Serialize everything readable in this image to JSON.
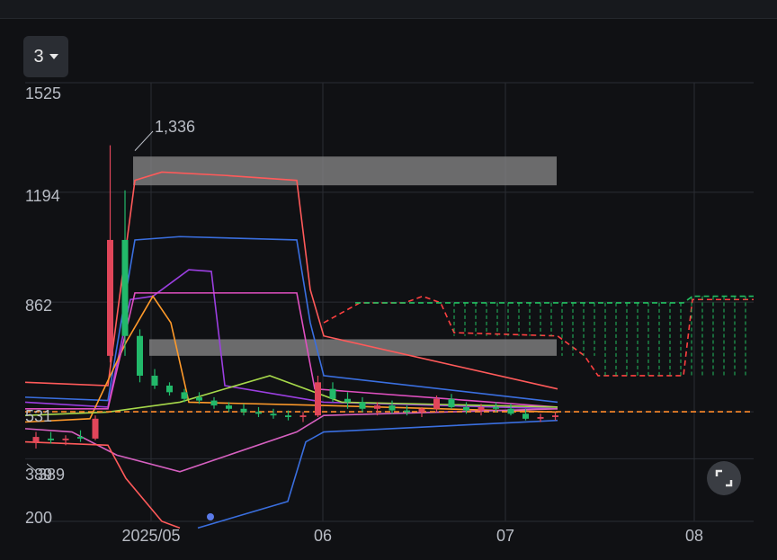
{
  "period_button": {
    "label": "3"
  },
  "chart_data": {
    "type": "candlestick",
    "y_ticks": [
      "1525",
      "1194",
      "862",
      "531",
      "389",
      "200"
    ],
    "x_ticks": [
      "2025/05",
      "06",
      "07",
      "08"
    ],
    "ylim": [
      200,
      1525
    ],
    "annotations": {
      "high_label": "1,336",
      "low_label": "389"
    },
    "grid": true,
    "candles": [
      {
        "x": 0,
        "o": 440,
        "h": 470,
        "l": 420,
        "c": 455
      },
      {
        "x": 1,
        "o": 450,
        "h": 470,
        "l": 435,
        "c": 445
      },
      {
        "x": 2,
        "o": 445,
        "h": 460,
        "l": 430,
        "c": 450
      },
      {
        "x": 3,
        "o": 455,
        "h": 475,
        "l": 440,
        "c": 450
      },
      {
        "x": 4,
        "o": 450,
        "h": 520,
        "l": 445,
        "c": 510
      },
      {
        "x": 5,
        "o": 700,
        "h": 1336,
        "l": 680,
        "c": 1050
      },
      {
        "x": 6,
        "o": 1050,
        "h": 1200,
        "l": 700,
        "c": 760
      },
      {
        "x": 7,
        "o": 760,
        "h": 780,
        "l": 620,
        "c": 640
      },
      {
        "x": 8,
        "o": 640,
        "h": 660,
        "l": 600,
        "c": 610
      },
      {
        "x": 9,
        "o": 610,
        "h": 620,
        "l": 580,
        "c": 590
      },
      {
        "x": 10,
        "o": 590,
        "h": 600,
        "l": 560,
        "c": 570
      },
      {
        "x": 11,
        "o": 575,
        "h": 590,
        "l": 555,
        "c": 565
      },
      {
        "x": 12,
        "o": 565,
        "h": 575,
        "l": 540,
        "c": 550
      },
      {
        "x": 13,
        "o": 550,
        "h": 560,
        "l": 530,
        "c": 540
      },
      {
        "x": 14,
        "o": 540,
        "h": 555,
        "l": 520,
        "c": 530
      },
      {
        "x": 15,
        "o": 530,
        "h": 545,
        "l": 515,
        "c": 525
      },
      {
        "x": 16,
        "o": 525,
        "h": 540,
        "l": 510,
        "c": 520
      },
      {
        "x": 17,
        "o": 520,
        "h": 535,
        "l": 505,
        "c": 515
      },
      {
        "x": 18,
        "o": 515,
        "h": 530,
        "l": 500,
        "c": 520
      },
      {
        "x": 19,
        "o": 520,
        "h": 640,
        "l": 515,
        "c": 620
      },
      {
        "x": 20,
        "o": 600,
        "h": 620,
        "l": 560,
        "c": 570
      },
      {
        "x": 21,
        "o": 570,
        "h": 590,
        "l": 540,
        "c": 560
      },
      {
        "x": 22,
        "o": 560,
        "h": 575,
        "l": 530,
        "c": 540
      },
      {
        "x": 23,
        "o": 540,
        "h": 560,
        "l": 520,
        "c": 550
      },
      {
        "x": 24,
        "o": 550,
        "h": 565,
        "l": 525,
        "c": 535
      },
      {
        "x": 25,
        "o": 535,
        "h": 550,
        "l": 520,
        "c": 530
      },
      {
        "x": 26,
        "o": 530,
        "h": 545,
        "l": 515,
        "c": 540
      },
      {
        "x": 27,
        "o": 540,
        "h": 580,
        "l": 530,
        "c": 570
      },
      {
        "x": 28,
        "o": 570,
        "h": 585,
        "l": 540,
        "c": 545
      },
      {
        "x": 29,
        "o": 545,
        "h": 560,
        "l": 525,
        "c": 535
      },
      {
        "x": 30,
        "o": 535,
        "h": 555,
        "l": 520,
        "c": 545
      },
      {
        "x": 31,
        "o": 545,
        "h": 560,
        "l": 530,
        "c": 540
      },
      {
        "x": 32,
        "o": 540,
        "h": 555,
        "l": 520,
        "c": 525
      },
      {
        "x": 33,
        "o": 525,
        "h": 540,
        "l": 505,
        "c": 510
      },
      {
        "x": 34,
        "o": 510,
        "h": 525,
        "l": 500,
        "c": 515
      },
      {
        "x": 35,
        "o": 515,
        "h": 530,
        "l": 505,
        "c": 520
      }
    ],
    "colors": {
      "up": "#e0465a",
      "down": "#22b96a",
      "grid": "#2a2d33",
      "text": "#b8bcc4"
    }
  }
}
